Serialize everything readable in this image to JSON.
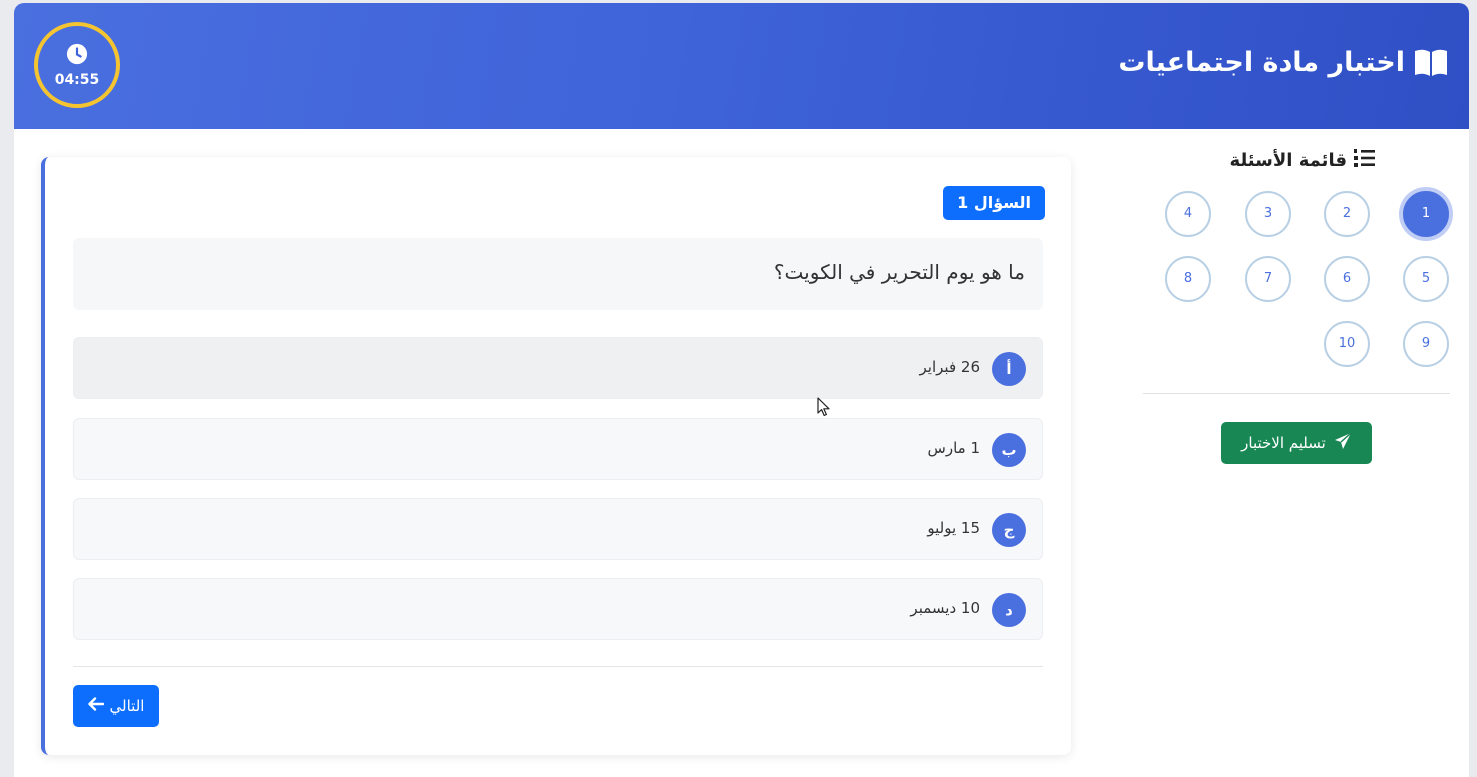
{
  "header": {
    "title": "اختبار مادة اجتماعيات",
    "title_icon": "book-open-icon",
    "timer": "04:55",
    "timer_icon": "clock-icon"
  },
  "question": {
    "badge": "السؤال 1",
    "text": "ما هو يوم التحرير في الكويت؟",
    "options": [
      {
        "letter": "أ",
        "label": "26 فبراير"
      },
      {
        "letter": "ب",
        "label": "1 مارس"
      },
      {
        "letter": "ج",
        "label": "15 يوليو"
      },
      {
        "letter": "د",
        "label": "10 ديسمبر"
      }
    ],
    "next_label": "التالي"
  },
  "sidebar": {
    "title": "قائمة الأسئلة",
    "title_icon": "list-ol-icon",
    "numbers": [
      "1",
      "2",
      "3",
      "4",
      "5",
      "6",
      "7",
      "8",
      "9",
      "10"
    ],
    "active": "1",
    "submit_label": "تسليم الاختبار",
    "submit_icon": "paper-plane-icon"
  },
  "colors": {
    "header_start": "#4a6fdf",
    "header_end": "#2f4fc5",
    "timer_ring": "#f5c431",
    "primary": "#0d6efd",
    "accent": "#4a6fdf",
    "success": "#198754"
  }
}
